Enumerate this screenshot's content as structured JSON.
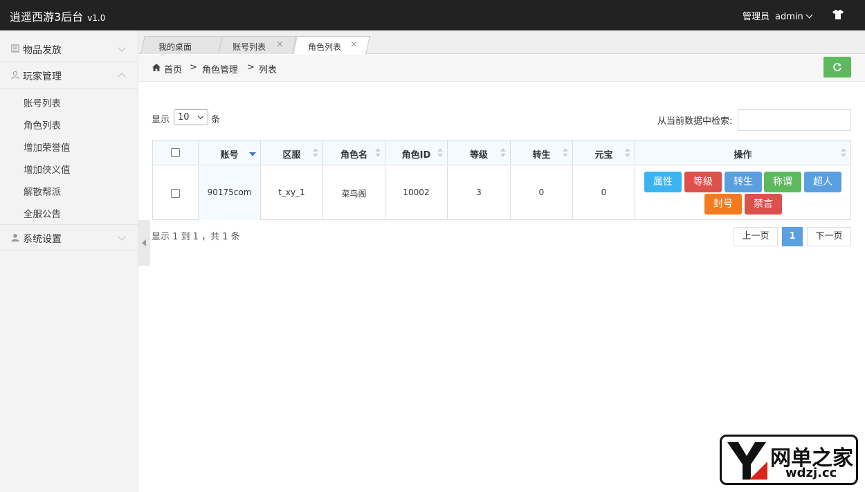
{
  "header": {
    "title": "逍遥西游3后台",
    "version": "v1.0",
    "role": "管理员",
    "username": "admin"
  },
  "sidebar": {
    "groups": [
      {
        "label": "物品发放",
        "icon": "book-icon",
        "expanded": false
      },
      {
        "label": "玩家管理",
        "icon": "user-outline-icon",
        "expanded": true
      },
      {
        "label": "系统设置",
        "icon": "user-icon",
        "expanded": false
      }
    ],
    "sub_items": [
      "账号列表",
      "角色列表",
      "增加荣誉值",
      "增加侠义值",
      "解散帮派",
      "全服公告"
    ]
  },
  "tabs": [
    {
      "label": "我的桌面",
      "active": false,
      "closable": false
    },
    {
      "label": "账号列表",
      "active": false,
      "closable": true
    },
    {
      "label": "角色列表",
      "active": true,
      "closable": true
    }
  ],
  "tab_close_glyph": "×",
  "breadcrumb": {
    "items": [
      "首页",
      "角色管理",
      "列表"
    ],
    "separator": ">"
  },
  "table_controls": {
    "show_prefix": "显示",
    "page_length": "10",
    "show_suffix": "条",
    "search_label": "从当前数据中检索:",
    "search_value": ""
  },
  "table": {
    "columns": [
      "账号",
      "区服",
      "角色名",
      "角色ID",
      "等级",
      "转生",
      "元宝",
      "操作"
    ],
    "rows": [
      {
        "account": "90175com",
        "server": "t_xy_1",
        "role_name": "菜鸟阁",
        "role_id": "10002",
        "level": "3",
        "rebirth": "0",
        "ingot": "0"
      }
    ],
    "actions": [
      {
        "label": "属性",
        "color": "#3bb4f2"
      },
      {
        "label": "等级",
        "color": "#dd514c"
      },
      {
        "label": "转生",
        "color": "#5a9fe0"
      },
      {
        "label": "称谓",
        "color": "#5eb95e"
      },
      {
        "label": "超人",
        "color": "#5a9fe0"
      },
      {
        "label": "封号",
        "color": "#f37b1d"
      },
      {
        "label": "禁言",
        "color": "#dd514c"
      }
    ]
  },
  "footer": {
    "info": "显示 1 到 1 ，共 1 条",
    "prev": "上一页",
    "current_page": "1",
    "next": "下一页"
  },
  "watermark": {
    "text": "网单之家",
    "url": "wdzj.cc"
  },
  "colors": {
    "header_bg": "#222222",
    "accent_green": "#5eb95e",
    "accent_blue": "#5a9fe0"
  }
}
